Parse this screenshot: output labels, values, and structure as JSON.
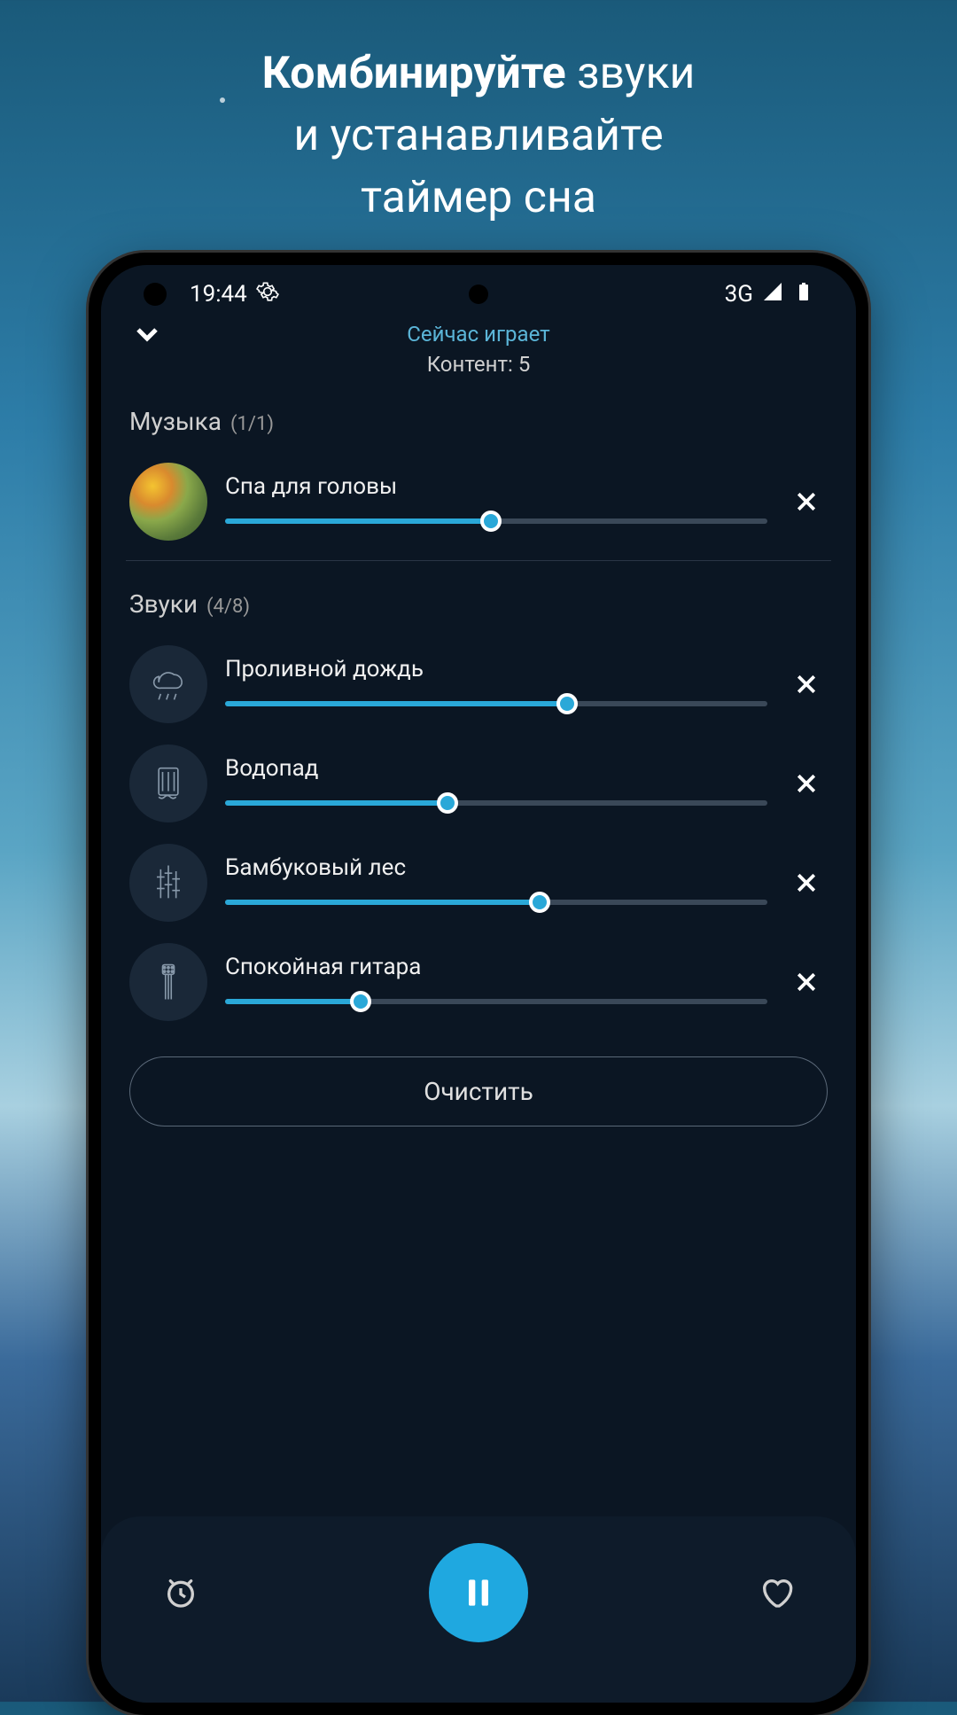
{
  "promo": {
    "line1_bold": "Комбинируйте",
    "line1_rest": " звуки",
    "line2": "и устанавливайте",
    "line3": "таймер сна"
  },
  "status": {
    "time": "19:44",
    "network": "3G"
  },
  "header": {
    "now_playing": "Сейчас играет",
    "content_prefix": "Контент: ",
    "content_count": "5"
  },
  "sections": {
    "music": {
      "title": "Музыка",
      "count": "(1/1)",
      "items": [
        {
          "title": "Спа для головы",
          "volume": 49
        }
      ]
    },
    "sounds": {
      "title": "Звуки",
      "count": "(4/8)",
      "items": [
        {
          "title": "Проливной дождь",
          "volume": 63,
          "icon": "rain"
        },
        {
          "title": "Водопад",
          "volume": 41,
          "icon": "waterfall"
        },
        {
          "title": "Бамбуковый лес",
          "volume": 58,
          "icon": "bamboo"
        },
        {
          "title": "Спокойная гитара",
          "volume": 25,
          "icon": "guitar"
        }
      ]
    }
  },
  "buttons": {
    "clear": "Очистить"
  }
}
